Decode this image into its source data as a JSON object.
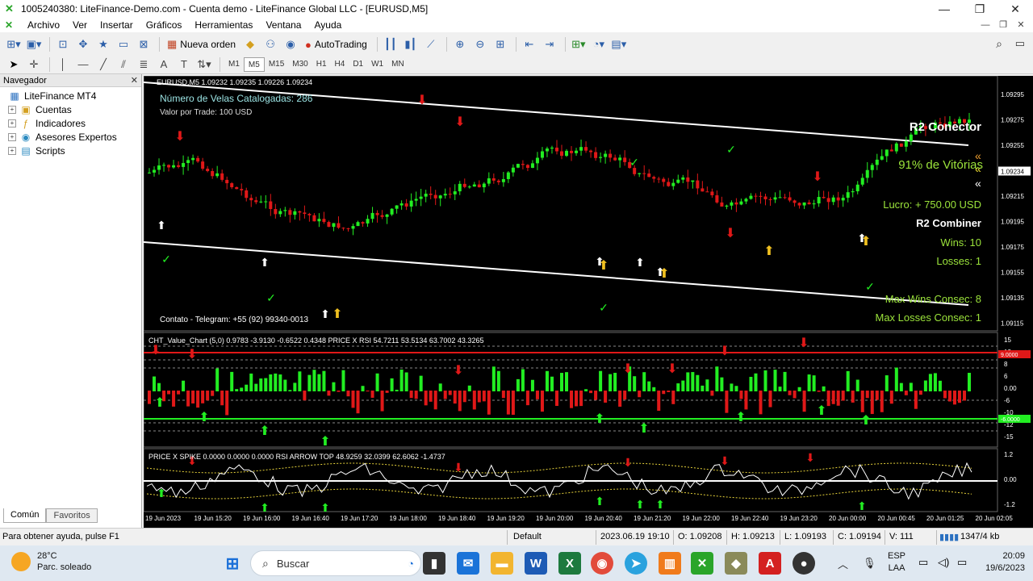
{
  "window": {
    "title": "1005240380: LiteFinance-Demo.com - Cuenta demo - LiteFinance Global LLC - [EURUSD,M5]"
  },
  "menu": [
    "Archivo",
    "Ver",
    "Insertar",
    "Gráficos",
    "Herramientas",
    "Ventana",
    "Ayuda"
  ],
  "toolbar": {
    "new_order": "Nueva orden",
    "autotrading": "AutoTrading",
    "timeframes": [
      "M1",
      "M5",
      "M15",
      "M30",
      "H1",
      "H4",
      "D1",
      "W1",
      "MN"
    ],
    "active_timeframe": "M5"
  },
  "navigator": {
    "title": "Navegador",
    "root": "LiteFinance MT4",
    "items": [
      "Cuentas",
      "Indicadores",
      "Asesores Expertos",
      "Scripts"
    ],
    "tabs": [
      "Común",
      "Favoritos"
    ]
  },
  "chart": {
    "symbol_header": "EURUSD,M5  1.09232 1.09235 1.09226 1.09234",
    "candles_count_label": "Número de Velas Catalogadas: 286",
    "trade_value_label": "Valor por Trade: 100 USD",
    "contact_label": "Contato - Telegram: +55 (92) 99340-0013",
    "price_axis": [
      "1.09295",
      "1.09275",
      "1.09255",
      "1.09234",
      "1.09215",
      "1.09195",
      "1.09175",
      "1.09155",
      "1.09135",
      "1.09115"
    ],
    "current_price": "1.09234",
    "panel": {
      "conector_title": "R2 Conector",
      "win_rate": "91% de Vitórias",
      "profit": "Lucro: + 750.00 USD",
      "combiner_title": "R2 Combiner",
      "wins": "Wins: 10",
      "losses": "Losses: 1",
      "max_wins": "Max Wins Consec: 8",
      "max_losses": "Max Losses Consec: 1"
    },
    "indicator1_header": "CHT_Value_Chart (5,0) 0.9783 -3.9130 -0.6522 0.4348  PRICE X RSI 54.7211 53.5134 63.7002 43.3265",
    "indicator1_axis": [
      "15",
      "12",
      "8",
      "6",
      "0.00",
      "-6",
      "-10",
      "-12",
      "-15"
    ],
    "indicator1_marker_top": "9.0000",
    "indicator1_marker_bottom": "-6.0000",
    "indicator2_header": "PRICE X SPIKE 0.0000 0.0000 0.0000  RSI ARROW TOP 48.9259 32.0399 62.6062 -1.4737",
    "indicator2_axis": [
      "1.2",
      "0.00",
      "-1.2"
    ],
    "time_axis": [
      "19 Jun 2023",
      "19 Jun 15:20",
      "19 Jun 16:00",
      "19 Jun 16:40",
      "19 Jun 17:20",
      "19 Jun 18:00",
      "19 Jun 18:40",
      "19 Jun 19:20",
      "19 Jun 20:00",
      "19 Jun 20:40",
      "19 Jun 21:20",
      "19 Jun 22:00",
      "19 Jun 22:40",
      "19 Jun 23:20",
      "20 Jun 00:00",
      "20 Jun 00:45",
      "20 Jun 01:25",
      "20 Jun 02:05"
    ]
  },
  "statusbar": {
    "help": "Para obtener ayuda, pulse F1",
    "profile": "Default",
    "datetime": "2023.06.19 19:10",
    "open": "O: 1.09208",
    "high": "H: 1.09213",
    "low": "L: 1.09193",
    "close": "C: 1.09194",
    "volume": "V: 111",
    "traffic": "1347/4 kb"
  },
  "taskbar": {
    "weather_temp": "28°C",
    "weather_desc": "Parc. soleado",
    "search_placeholder": "Buscar",
    "lang": "ESP",
    "lang_sub": "LAA",
    "time": "20:09",
    "date": "19/6/2023"
  },
  "colors": {
    "bull": "#22ee22",
    "bear": "#e01818",
    "chart_bg": "#000000",
    "panel_accent": "#9be33b"
  }
}
